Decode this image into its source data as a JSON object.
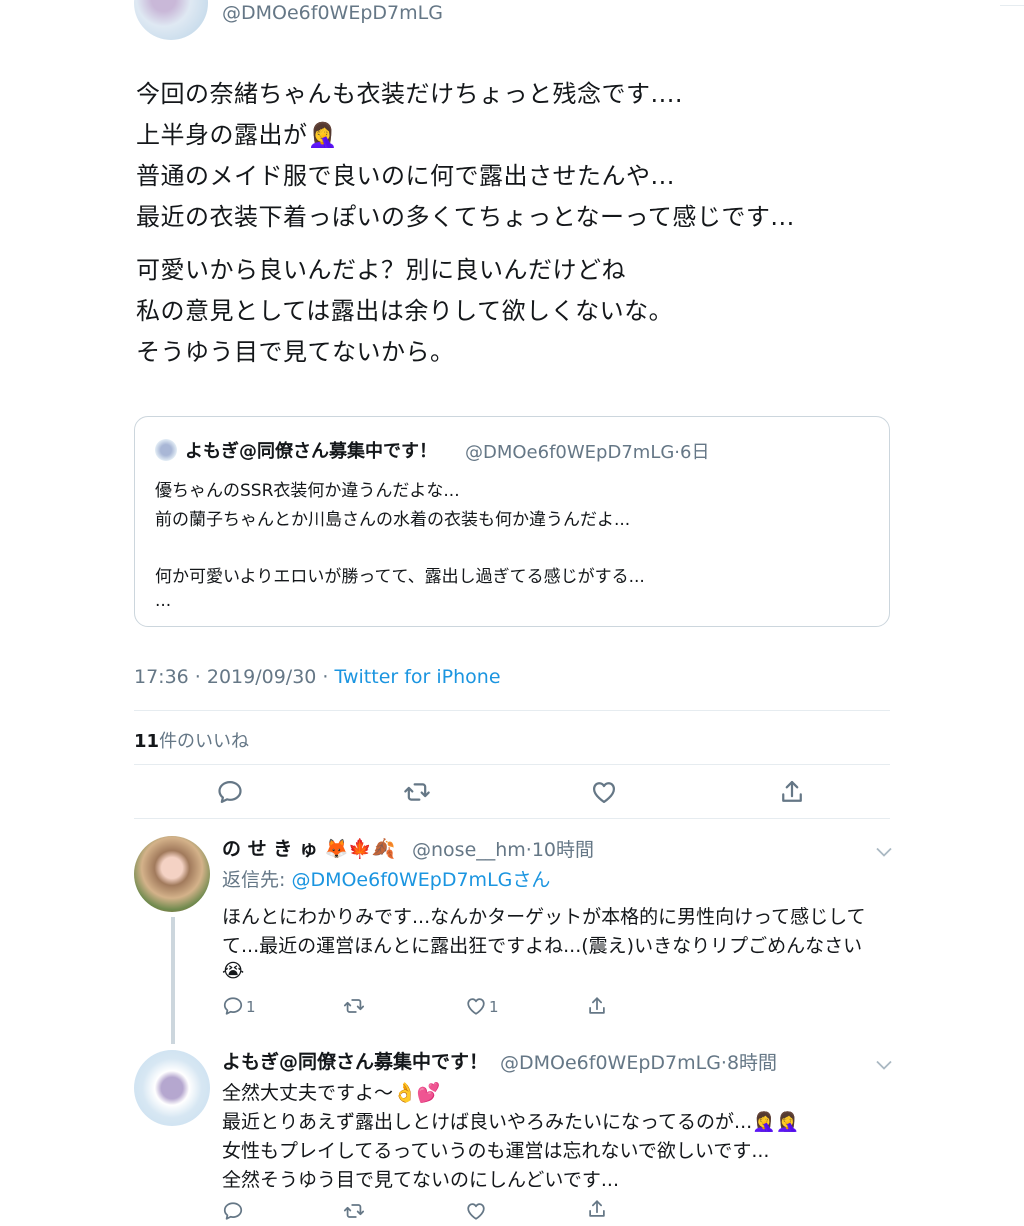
{
  "tweet": {
    "handle": "@DMOe6f0WEpD7mLG",
    "lines": [
      "今回の奈緒ちゃんも衣装だけちょっと残念です....",
      "上半身の露出が🤦‍♀️",
      "普通のメイド服で良いのに何で露出させたんや...",
      "最近の衣装下着っぽいの多くてちょっとなーって感じです...",
      "可愛いから良いんだよ？別に良いんだけどね",
      "私の意見としては露出は余りして欲しくないな。",
      "そうゆう目で見てないから。"
    ],
    "quote": {
      "name": "よもぎ@同僚さん募集中です！",
      "handle_time": "@DMOe6f0WEpD7mLG·6日",
      "lines": [
        "優ちゃんのSSR衣装何か違うんだよな...",
        "前の蘭子ちゃんとか川島さんの水着の衣装も何か違うんだよ...",
        "何か可愛いよりエロいが勝ってて、露出し過ぎてる感じがする...",
        "..."
      ]
    },
    "time_date": "17:36 · 2019/09/30 · ",
    "client": "Twitter for iPhone",
    "likes_count": "11",
    "likes_label": "件のいいね",
    "actions": [
      "reply-icon",
      "retweet-icon",
      "like-icon",
      "share-icon"
    ]
  },
  "replies": [
    {
      "name": "の せ き ゅ 🦊🍁🍂",
      "meta": "@nose__hm·10時間",
      "reply_to_label": "返信先: ",
      "reply_to_handle": "@DMOe6f0WEpD7mLGさん",
      "lines": [
        "ほんとにわかりみです...なんかターゲットが本格的に男性向けって感じして",
        "て...最近の運営ほんとに露出狂ですよね...(震え)いきなりリプごめんなさい",
        "😭"
      ],
      "reply_count": "1",
      "like_count": "1"
    },
    {
      "name": "よもぎ@同僚さん募集中です！",
      "meta": "@DMOe6f0WEpD7mLG·8時間",
      "lines": [
        "全然大丈夫ですよ〜👌💕",
        "最近とりあえず露出しとけば良いやろみたいになってるのが...🤦‍♀️🤦‍♀️",
        "女性もプレイしてるっていうのも運営は忘れないで欲しいです...",
        "全然そうゆう目で見てないのにしんどいです..."
      ]
    }
  ]
}
